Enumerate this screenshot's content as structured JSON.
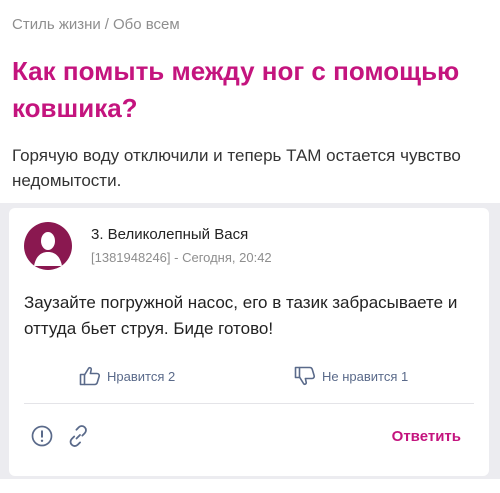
{
  "breadcrumb": {
    "category": "Стиль жизни",
    "separator": "/",
    "subcategory": "Обо всем"
  },
  "question": {
    "title": "Как помыть между ног с помощью ковшика?",
    "body": "Горячую воду отключили и теперь ТАМ остается чувство недомытости."
  },
  "answer": {
    "author": "3. Великолепный Вася",
    "meta": "[1381948246] - Сегодня, 20:42",
    "text": "Заузайте погружной насос, его в тазик забрасываете и оттуда бьет струя. Биде готово!",
    "like_label": "Нравится 2",
    "dislike_label": "Не нравится 1",
    "reply_label": "Ответить"
  },
  "colors": {
    "accent": "#c4147e",
    "avatar_bg": "#8a1850",
    "vote_icon": "#5a6a8a",
    "muted": "#8e8e8e"
  },
  "icons": {
    "like": "thumbs-up-icon",
    "dislike": "thumbs-down-icon",
    "report": "report-icon",
    "link": "link-icon",
    "avatar": "user-silhouette-icon"
  }
}
